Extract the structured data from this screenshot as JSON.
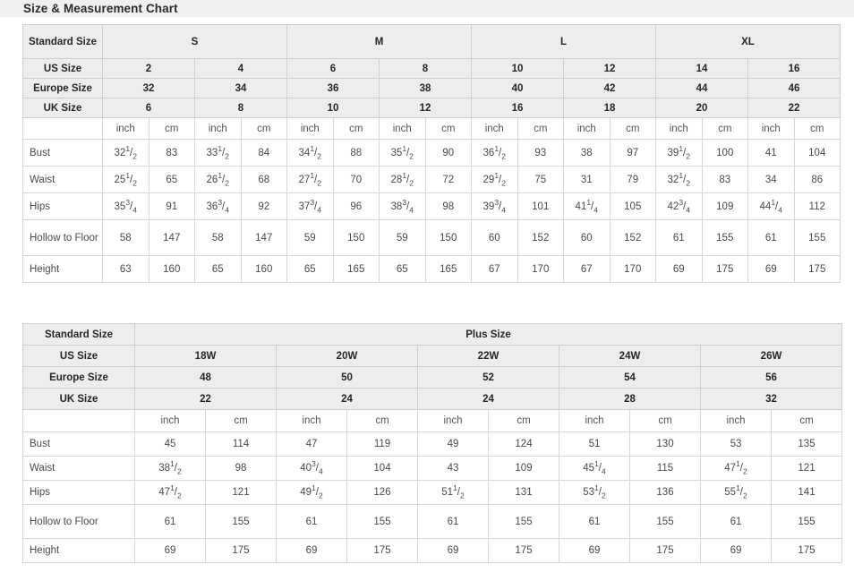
{
  "page": {
    "title": "Size & Measurement Chart"
  },
  "standard_table": {
    "row_label_header": "Standard Size",
    "group_header_row": {
      "label": "Standard Size",
      "groups": [
        {
          "label": "S",
          "span": 4
        },
        {
          "label": "M",
          "span": 4
        },
        {
          "label": "L",
          "span": 4
        },
        {
          "label": "XL",
          "span": 4
        }
      ]
    },
    "size_rows": [
      {
        "label": "US Size",
        "values": [
          "2",
          "4",
          "6",
          "8",
          "10",
          "12",
          "14",
          "16"
        ]
      },
      {
        "label": "Europe Size",
        "values": [
          "32",
          "34",
          "36",
          "38",
          "40",
          "42",
          "44",
          "46"
        ]
      },
      {
        "label": "UK Size",
        "values": [
          "6",
          "8",
          "10",
          "12",
          "16",
          "18",
          "20",
          "22"
        ]
      }
    ],
    "unit_row": {
      "label": "",
      "units": [
        "inch",
        "cm",
        "inch",
        "cm",
        "inch",
        "cm",
        "inch",
        "cm",
        "inch",
        "cm",
        "inch",
        "cm",
        "inch",
        "cm",
        "inch",
        "cm"
      ]
    },
    "measurement_rows": [
      {
        "label": "Bust",
        "tall": false,
        "values": [
          {
            "whole": "32",
            "num": "1",
            "den": "2"
          },
          {
            "whole": "83"
          },
          {
            "whole": "33",
            "num": "1",
            "den": "2"
          },
          {
            "whole": "84"
          },
          {
            "whole": "34",
            "num": "1",
            "den": "2"
          },
          {
            "whole": "88"
          },
          {
            "whole": "35",
            "num": "1",
            "den": "2"
          },
          {
            "whole": "90"
          },
          {
            "whole": "36",
            "num": "1",
            "den": "2"
          },
          {
            "whole": "93"
          },
          {
            "whole": "38"
          },
          {
            "whole": "97"
          },
          {
            "whole": "39",
            "num": "1",
            "den": "2"
          },
          {
            "whole": "100"
          },
          {
            "whole": "41"
          },
          {
            "whole": "104"
          }
        ]
      },
      {
        "label": "Waist",
        "tall": false,
        "values": [
          {
            "whole": "25",
            "num": "1",
            "den": "2"
          },
          {
            "whole": "65"
          },
          {
            "whole": "26",
            "num": "1",
            "den": "2"
          },
          {
            "whole": "68"
          },
          {
            "whole": "27",
            "num": "1",
            "den": "2"
          },
          {
            "whole": "70"
          },
          {
            "whole": "28",
            "num": "1",
            "den": "2"
          },
          {
            "whole": "72"
          },
          {
            "whole": "29",
            "num": "1",
            "den": "2"
          },
          {
            "whole": "75"
          },
          {
            "whole": "31"
          },
          {
            "whole": "79"
          },
          {
            "whole": "32",
            "num": "1",
            "den": "2"
          },
          {
            "whole": "83"
          },
          {
            "whole": "34"
          },
          {
            "whole": "86"
          }
        ]
      },
      {
        "label": "Hips",
        "tall": false,
        "values": [
          {
            "whole": "35",
            "num": "3",
            "den": "4"
          },
          {
            "whole": "91"
          },
          {
            "whole": "36",
            "num": "3",
            "den": "4"
          },
          {
            "whole": "92"
          },
          {
            "whole": "37",
            "num": "3",
            "den": "4"
          },
          {
            "whole": "96"
          },
          {
            "whole": "38",
            "num": "3",
            "den": "4"
          },
          {
            "whole": "98"
          },
          {
            "whole": "39",
            "num": "3",
            "den": "4"
          },
          {
            "whole": "101"
          },
          {
            "whole": "41",
            "num": "1",
            "den": "4"
          },
          {
            "whole": "105"
          },
          {
            "whole": "42",
            "num": "3",
            "den": "4"
          },
          {
            "whole": "109"
          },
          {
            "whole": "44",
            "num": "1",
            "den": "4"
          },
          {
            "whole": "112"
          }
        ]
      },
      {
        "label": "Hollow to Floor",
        "tall": true,
        "values": [
          {
            "whole": "58"
          },
          {
            "whole": "147"
          },
          {
            "whole": "58"
          },
          {
            "whole": "147"
          },
          {
            "whole": "59"
          },
          {
            "whole": "150"
          },
          {
            "whole": "59"
          },
          {
            "whole": "150"
          },
          {
            "whole": "60"
          },
          {
            "whole": "152"
          },
          {
            "whole": "60"
          },
          {
            "whole": "152"
          },
          {
            "whole": "61"
          },
          {
            "whole": "155"
          },
          {
            "whole": "61"
          },
          {
            "whole": "155"
          }
        ]
      },
      {
        "label": "Height",
        "tall": false,
        "values": [
          {
            "whole": "63"
          },
          {
            "whole": "160"
          },
          {
            "whole": "65"
          },
          {
            "whole": "160"
          },
          {
            "whole": "65"
          },
          {
            "whole": "165"
          },
          {
            "whole": "65"
          },
          {
            "whole": "165"
          },
          {
            "whole": "67"
          },
          {
            "whole": "170"
          },
          {
            "whole": "67"
          },
          {
            "whole": "170"
          },
          {
            "whole": "69"
          },
          {
            "whole": "175"
          },
          {
            "whole": "69"
          },
          {
            "whole": "175"
          }
        ]
      }
    ]
  },
  "plus_table": {
    "group_header_row": {
      "label": "Standard Size",
      "group_label": "Plus Size"
    },
    "size_rows": [
      {
        "label": "US Size",
        "values": [
          "18W",
          "20W",
          "22W",
          "24W",
          "26W"
        ]
      },
      {
        "label": "Europe Size",
        "values": [
          "48",
          "50",
          "52",
          "54",
          "56"
        ]
      },
      {
        "label": "UK Size",
        "values": [
          "22",
          "24",
          "24",
          "28",
          "32"
        ]
      }
    ],
    "unit_row": {
      "label": "",
      "units": [
        "inch",
        "cm",
        "inch",
        "cm",
        "inch",
        "cm",
        "inch",
        "cm",
        "inch",
        "cm"
      ]
    },
    "measurement_rows": [
      {
        "label": "Bust",
        "tall": false,
        "values": [
          {
            "whole": "45"
          },
          {
            "whole": "114"
          },
          {
            "whole": "47"
          },
          {
            "whole": "119"
          },
          {
            "whole": "49"
          },
          {
            "whole": "124"
          },
          {
            "whole": "51"
          },
          {
            "whole": "130"
          },
          {
            "whole": "53"
          },
          {
            "whole": "135"
          }
        ]
      },
      {
        "label": "Waist",
        "tall": false,
        "values": [
          {
            "whole": "38",
            "num": "1",
            "den": "2"
          },
          {
            "whole": "98"
          },
          {
            "whole": "40",
            "num": "3",
            "den": "4"
          },
          {
            "whole": "104"
          },
          {
            "whole": "43"
          },
          {
            "whole": "109"
          },
          {
            "whole": "45",
            "num": "1",
            "den": "4"
          },
          {
            "whole": "115"
          },
          {
            "whole": "47",
            "num": "1",
            "den": "2"
          },
          {
            "whole": "121"
          }
        ]
      },
      {
        "label": "Hips",
        "tall": false,
        "values": [
          {
            "whole": "47",
            "num": "1",
            "den": "2"
          },
          {
            "whole": "121"
          },
          {
            "whole": "49",
            "num": "1",
            "den": "2"
          },
          {
            "whole": "126"
          },
          {
            "whole": "51",
            "num": "1",
            "den": "2"
          },
          {
            "whole": "131"
          },
          {
            "whole": "53",
            "num": "1",
            "den": "2"
          },
          {
            "whole": "136"
          },
          {
            "whole": "55",
            "num": "1",
            "den": "2"
          },
          {
            "whole": "141"
          }
        ]
      },
      {
        "label": "Hollow to Floor",
        "tall": true,
        "values": [
          {
            "whole": "61"
          },
          {
            "whole": "155"
          },
          {
            "whole": "61"
          },
          {
            "whole": "155"
          },
          {
            "whole": "61"
          },
          {
            "whole": "155"
          },
          {
            "whole": "61"
          },
          {
            "whole": "155"
          },
          {
            "whole": "61"
          },
          {
            "whole": "155"
          }
        ]
      },
      {
        "label": "Height",
        "tall": false,
        "values": [
          {
            "whole": "69"
          },
          {
            "whole": "175"
          },
          {
            "whole": "69"
          },
          {
            "whole": "175"
          },
          {
            "whole": "69"
          },
          {
            "whole": "175"
          },
          {
            "whole": "69"
          },
          {
            "whole": "175"
          },
          {
            "whole": "69"
          },
          {
            "whole": "175"
          }
        ]
      }
    ]
  },
  "colors": {
    "header_background": "#ededed",
    "title_background": "#f0f0f0",
    "border": "#d7d7d7",
    "text": "#4a4a4a",
    "heading_text": "#262626"
  }
}
